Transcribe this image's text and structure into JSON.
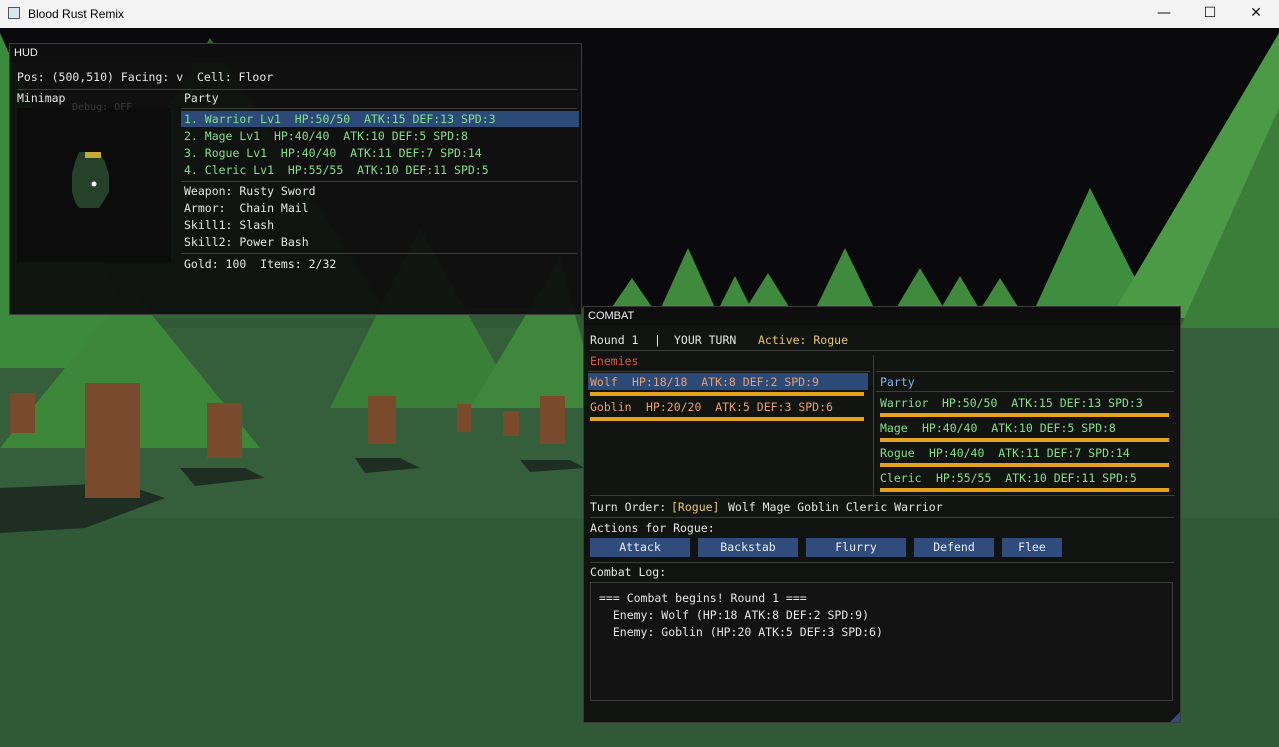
{
  "window": {
    "title": "Blood Rust Remix"
  },
  "hud": {
    "title": "HUD",
    "status": "Pos: (500,510) Facing: v  Cell: Floor",
    "minimap_label": "Minimap",
    "debug_text": "Debug: OFF",
    "party_label": "Party",
    "party": [
      "1. Warrior Lv1  HP:50/50  ATK:15 DEF:13 SPD:3",
      "2. Mage Lv1  HP:40/40  ATK:10 DEF:5 SPD:8",
      "3. Rogue Lv1  HP:40/40  ATK:11 DEF:7 SPD:14",
      "4. Cleric Lv1  HP:55/55  ATK:10 DEF:11 SPD:5"
    ],
    "equipment": [
      "Weapon: Rusty Sword",
      "Armor:  Chain Mail",
      "Skill1: Slash",
      "Skill2: Power Bash"
    ],
    "inventory": "Gold: 100  Items: 2/32"
  },
  "combat": {
    "title": "COMBAT",
    "round": "Round 1",
    "divider": "|",
    "turn": "YOUR TURN",
    "active": "Active: Rogue",
    "enemies_label": "Enemies",
    "enemies": [
      {
        "name": "Wolf",
        "stats": "HP:18/18  ATK:8 DEF:2 SPD:9",
        "hp_fraction": 1.0
      },
      {
        "name": "Goblin",
        "stats": "HP:20/20  ATK:5 DEF:3 SPD:6",
        "hp_fraction": 1.0
      }
    ],
    "party_label": "Party",
    "party": [
      {
        "name": "Warrior",
        "stats": "HP:50/50  ATK:15 DEF:13 SPD:3",
        "hp_fraction": 1.0
      },
      {
        "name": "Mage",
        "stats": "HP:40/40  ATK:10 DEF:5 SPD:8",
        "hp_fraction": 1.0
      },
      {
        "name": "Rogue",
        "stats": "HP:40/40  ATK:11 DEF:7 SPD:14",
        "hp_fraction": 1.0
      },
      {
        "name": "Cleric",
        "stats": "HP:55/55  ATK:10 DEF:11 SPD:5",
        "hp_fraction": 1.0
      }
    ],
    "turn_order_label": "Turn Order:",
    "turn_order_current": "[Rogue]",
    "turn_order_rest": "Wolf Mage Goblin Cleric Warrior",
    "actions_label": "Actions for Rogue:",
    "actions": [
      "Attack",
      "Backstab",
      "Flurry",
      "Defend",
      "Flee"
    ],
    "log_label": "Combat Log:",
    "log": [
      "=== Combat begins! Round 1 ===",
      "  Enemy: Wolf (HP:18 ATK:8 DEF:2 SPD:9)",
      "  Enemy: Goblin (HP:20 ATK:5 DEF:3 SPD:6)"
    ]
  },
  "colors": {
    "party_text": "#86e08a",
    "enemy_header": "#e05a4a",
    "party_header": "#7fb6ef",
    "active_text": "#e9c86a",
    "hp_bar": "#e7a21d",
    "button": "#2f4c7c",
    "selection": "#2b4a78"
  },
  "icons": [
    "app-icon",
    "minimize-icon",
    "maximize-icon",
    "close-icon"
  ]
}
